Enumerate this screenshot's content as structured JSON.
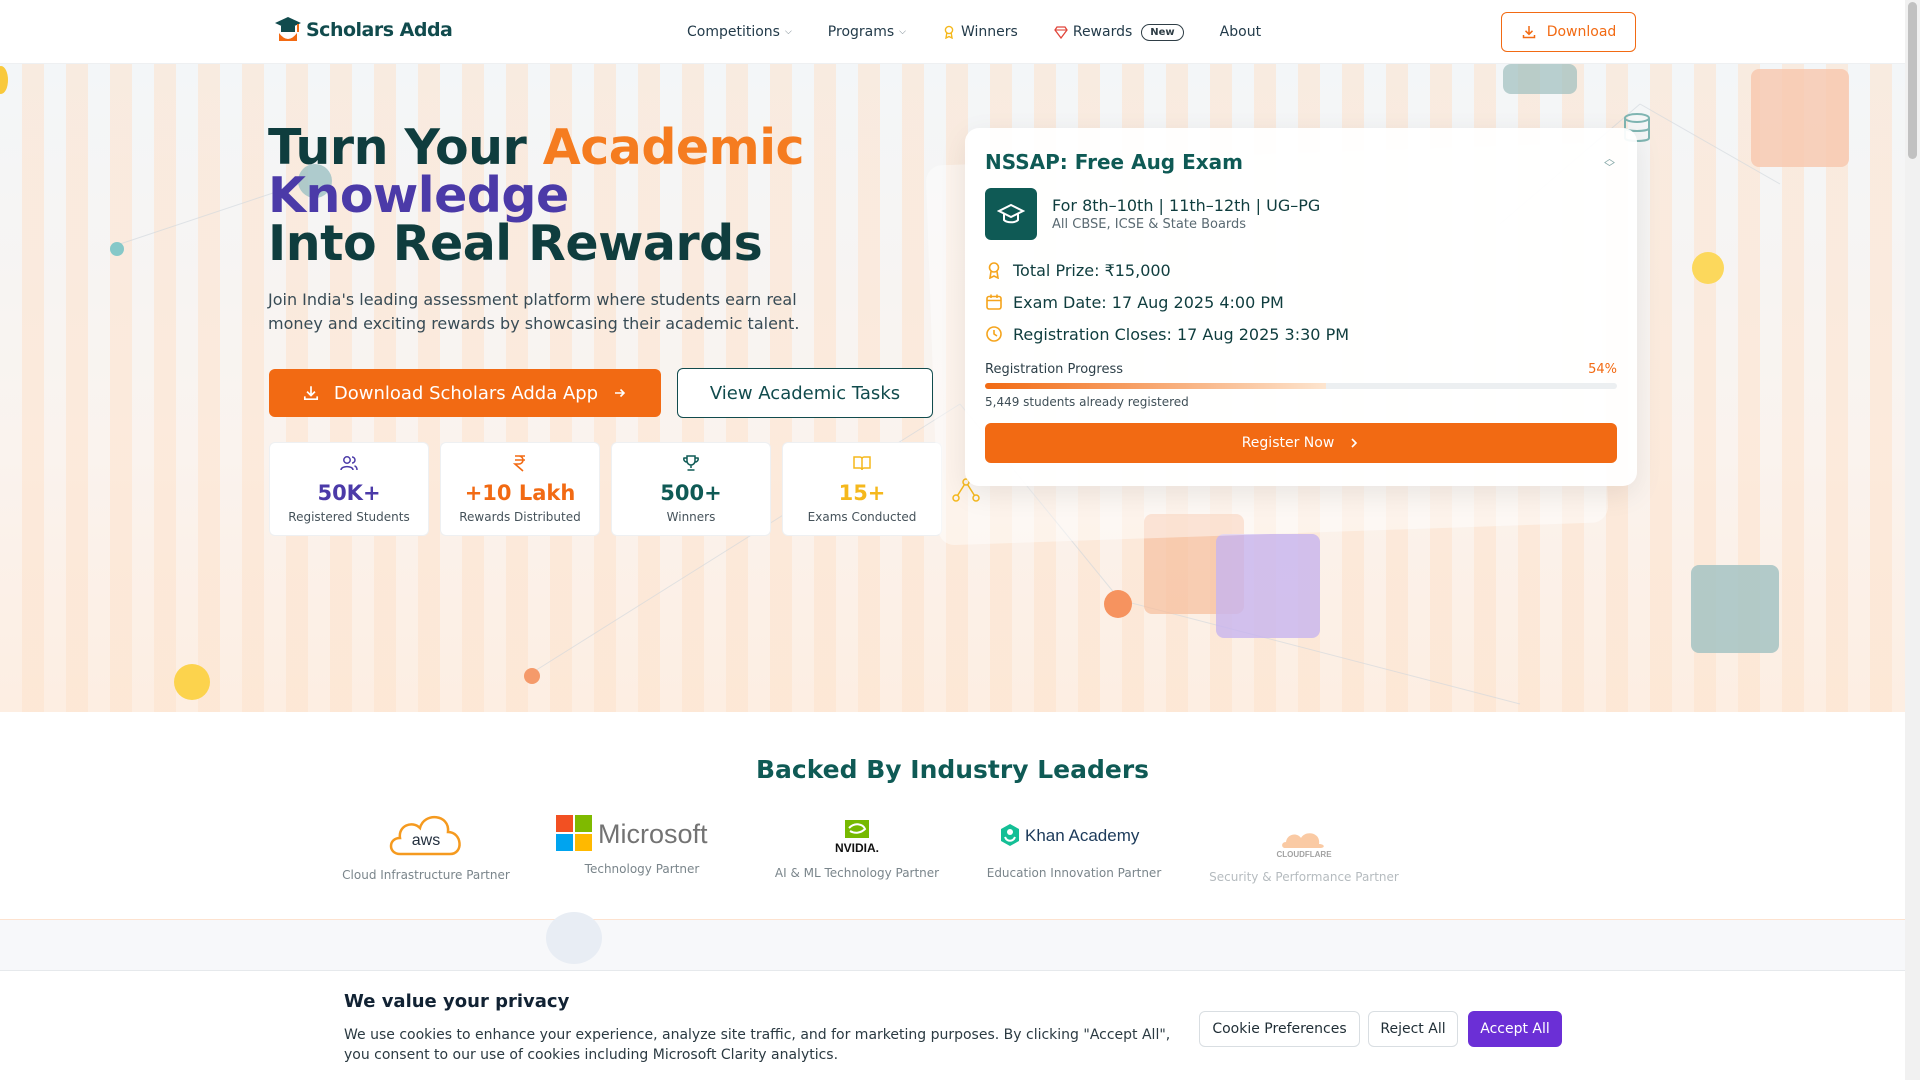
{
  "brand": {
    "name": "Scholars Adda"
  },
  "nav": {
    "items": [
      {
        "label": "Competitions",
        "has_dropdown": true
      },
      {
        "label": "Programs",
        "has_dropdown": true
      },
      {
        "label": "Winners",
        "icon": "award-icon"
      },
      {
        "label": "Rewards",
        "icon": "gem-icon",
        "badge": "New"
      },
      {
        "label": "About"
      }
    ],
    "download_label": "Download"
  },
  "hero": {
    "title_part1": "Turn Your ",
    "title_highlight1": "Academic",
    "title_highlight2": "Knowledge",
    "title_line3": "Into Real Rewards",
    "subtitle": "Join India's leading assessment platform where students earn real money and exciting rewards by showcasing their academic talent.",
    "cta_primary": "Download Scholars Adda App",
    "cta_secondary": "View Academic Tasks"
  },
  "stats": [
    {
      "value": "50K+",
      "label": "Registered Students",
      "icon": "users-icon",
      "color": "#4b3aa8"
    },
    {
      "value": "+10 Lakh",
      "label": "Rewards Distributed",
      "icon": "rupee-icon",
      "color": "#f26a13"
    },
    {
      "value": "500+",
      "label": "Winners",
      "icon": "trophy-icon",
      "color": "#0f5a55"
    },
    {
      "value": "15+",
      "label": "Exams Conducted",
      "icon": "book-icon",
      "color": "#f5b81c"
    }
  ],
  "exam_card": {
    "title": "NSSAP: Free Aug Exam",
    "grades": "For 8th–10th | 11th–12th | UG–PG",
    "boards": "All CBSE, ICSE & State Boards",
    "prize": "Total Prize: ₹15,000",
    "exam_date": "Exam Date: 17 Aug 2025 4:00 PM",
    "registration_closes": "Registration Closes: 17 Aug 2025 3:30 PM",
    "progress_label": "Registration Progress",
    "progress_percent_text": "54%",
    "progress_fraction": 0.54,
    "registered_note": "5,449 students already registered",
    "register_label": "Register Now"
  },
  "partners": {
    "title": "Backed By Industry Leaders",
    "items": [
      {
        "logo_text": "aws",
        "label": "Cloud Infrastructure Partner"
      },
      {
        "logo_text": "Microsoft",
        "label": "Technology Partner"
      },
      {
        "logo_text": "NVIDIA.",
        "label": "AI & ML Technology Partner"
      },
      {
        "logo_text": "Khan Academy",
        "label": "Education Innovation Partner"
      },
      {
        "logo_text": "CLOUDFLARE",
        "label": "Security & Performance Partner"
      }
    ]
  },
  "cookie": {
    "title": "We value your privacy",
    "text": "We use cookies to enhance your experience, analyze site traffic, and for marketing purposes. By clicking \"Accept All\", you consent to our use of cookies including Microsoft Clarity analytics.",
    "preferences_label": "Cookie Preferences",
    "reject_label": "Reject All",
    "accept_label": "Accept All"
  },
  "colors": {
    "accent": "#f26a13",
    "teal": "#0f5a55",
    "purple": "#4b3aa8",
    "accept": "#6b2fd6"
  }
}
